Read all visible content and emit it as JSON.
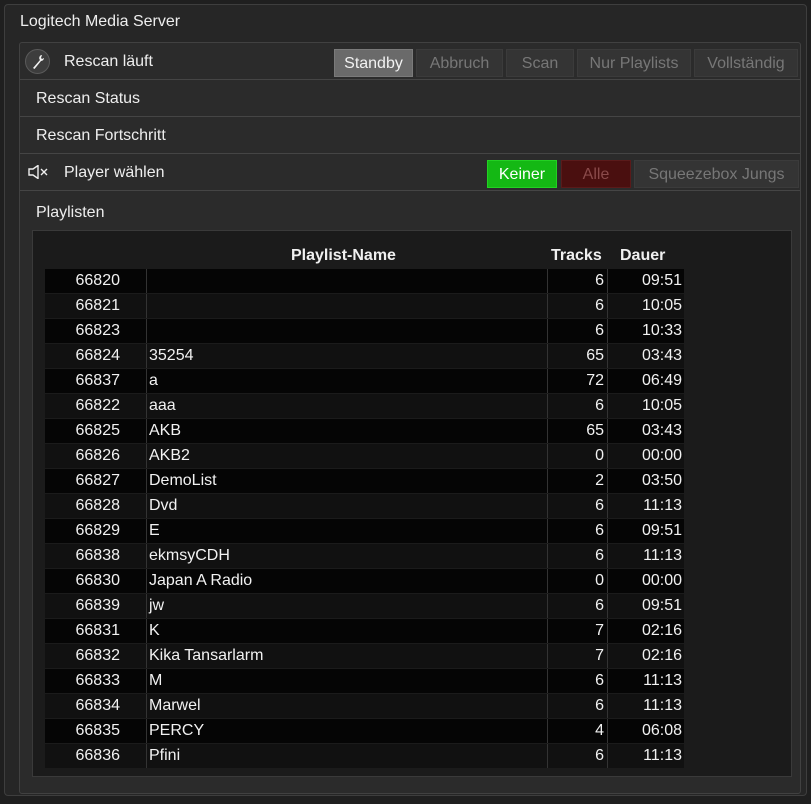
{
  "app_title": "Logitech Media Server",
  "rescan": {
    "label": "Rescan läuft",
    "buttons": [
      "Standby",
      "Abbruch",
      "Scan",
      "Nur Playlists",
      "Vollständig"
    ],
    "active": "Standby"
  },
  "rescan_status_label": "Rescan Status",
  "rescan_progress_label": "Rescan Fortschritt",
  "player": {
    "label": "Player wählen",
    "buttons": [
      "Keiner",
      "Alle",
      "Squeezebox Jungs"
    ],
    "active": "Keiner"
  },
  "playlists_label": "Playlisten",
  "table": {
    "headers": {
      "name": "Playlist-Name",
      "tracks": "Tracks",
      "duration": "Dauer"
    },
    "rows": [
      {
        "id": "66820",
        "name": "",
        "tracks": "6",
        "duration": "09:51"
      },
      {
        "id": "66821",
        "name": "",
        "tracks": "6",
        "duration": "10:05"
      },
      {
        "id": "66823",
        "name": "",
        "tracks": "6",
        "duration": "10:33"
      },
      {
        "id": "66824",
        "name": "35254",
        "tracks": "65",
        "duration": "03:43"
      },
      {
        "id": "66837",
        "name": "a",
        "tracks": "72",
        "duration": "06:49"
      },
      {
        "id": "66822",
        "name": "aaa",
        "tracks": "6",
        "duration": "10:05"
      },
      {
        "id": "66825",
        "name": "AKB",
        "tracks": "65",
        "duration": "03:43"
      },
      {
        "id": "66826",
        "name": "AKB2",
        "tracks": "0",
        "duration": "00:00"
      },
      {
        "id": "66827",
        "name": "DemoList",
        "tracks": "2",
        "duration": "03:50"
      },
      {
        "id": "66828",
        "name": "Dvd",
        "tracks": "6",
        "duration": "11:13"
      },
      {
        "id": "66829",
        "name": "E",
        "tracks": "6",
        "duration": "09:51"
      },
      {
        "id": "66838",
        "name": "ekmsyCDH",
        "tracks": "6",
        "duration": "11:13"
      },
      {
        "id": "66830",
        "name": "Japan A Radio",
        "tracks": "0",
        "duration": "00:00"
      },
      {
        "id": "66839",
        "name": "jw",
        "tracks": "6",
        "duration": "09:51"
      },
      {
        "id": "66831",
        "name": "K",
        "tracks": "7",
        "duration": "02:16"
      },
      {
        "id": "66832",
        "name": "Kika Tansarlarm",
        "tracks": "7",
        "duration": "02:16"
      },
      {
        "id": "66833",
        "name": "M",
        "tracks": "6",
        "duration": "11:13"
      },
      {
        "id": "66834",
        "name": "Marwel",
        "tracks": "6",
        "duration": "11:13"
      },
      {
        "id": "66835",
        "name": "PERCY",
        "tracks": "4",
        "duration": "06:08"
      },
      {
        "id": "66836",
        "name": "Pfini",
        "tracks": "6",
        "duration": "11:13"
      }
    ]
  },
  "icons": {
    "rescan": "wrench-icon",
    "player": "speaker-muted-icon"
  },
  "colors": {
    "active_green": "#14b814",
    "inactive_red": "#4a0f0f",
    "active_gray": "#6a6a6a"
  }
}
